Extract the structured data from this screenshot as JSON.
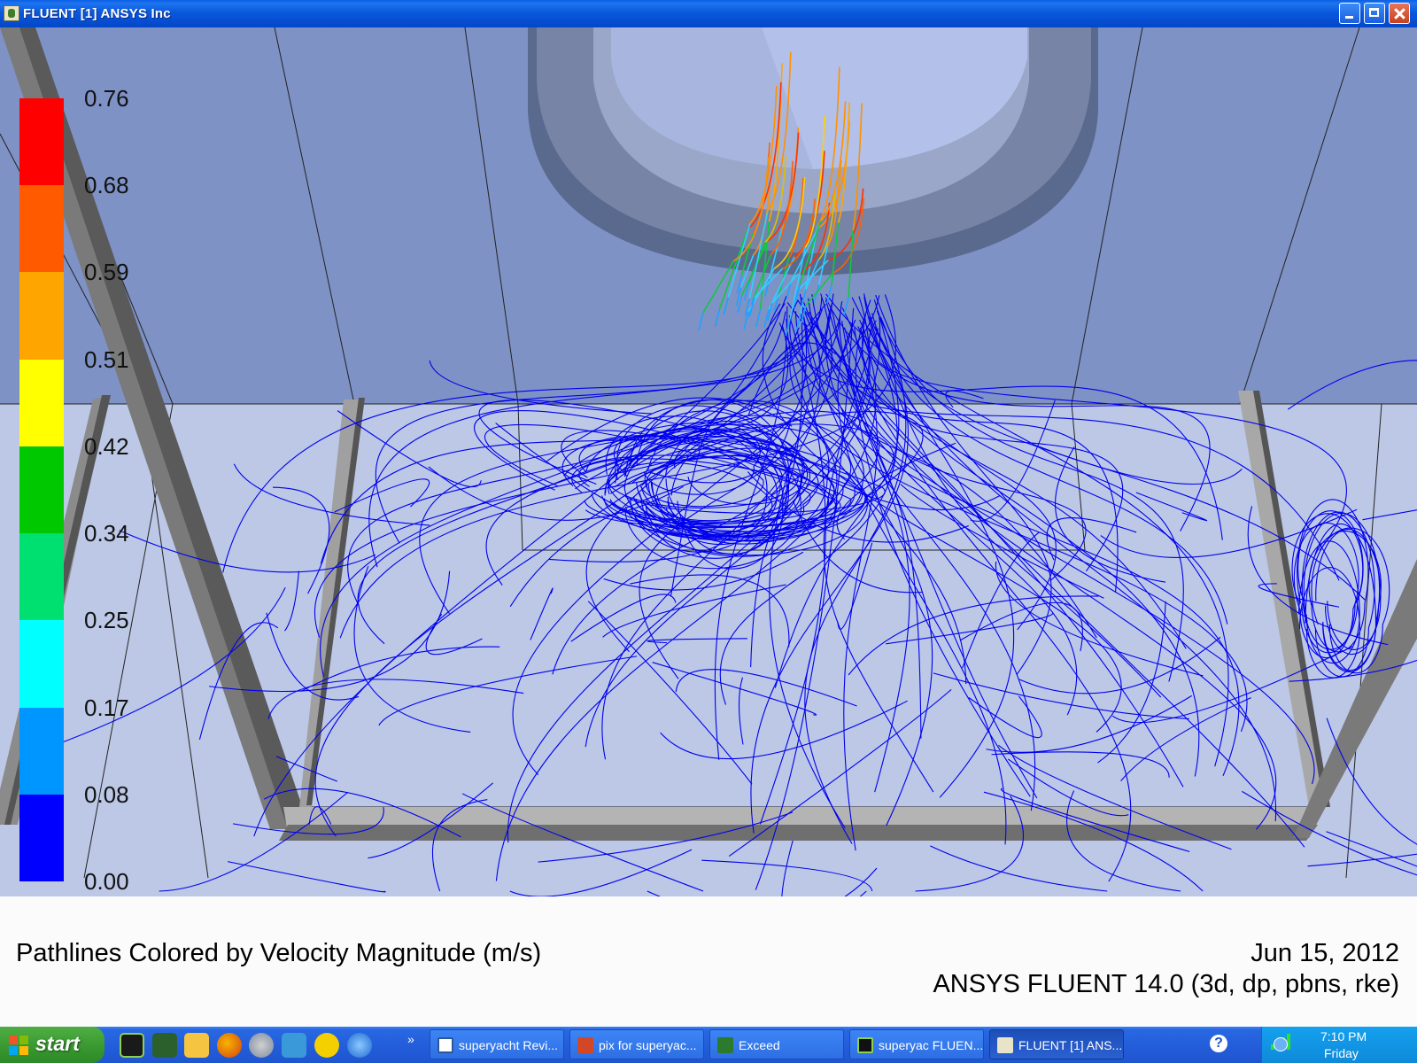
{
  "window": {
    "title": "FLUENT [1] ANSYS Inc"
  },
  "legend": {
    "labels": [
      "0.76",
      "0.68",
      "0.59",
      "0.51",
      "0.42",
      "0.34",
      "0.25",
      "0.17",
      "0.08",
      "0.00"
    ],
    "colors": [
      "#ff0000",
      "#ff5a00",
      "#ffa500",
      "#ffff00",
      "#00c800",
      "#00e070",
      "#00ffff",
      "#0096ff",
      "#0000ff"
    ]
  },
  "caption": {
    "title": "Pathlines Colored by Velocity Magnitude (m/s)",
    "date": "Jun 15, 2012",
    "version": "ANSYS FLUENT 14.0 (3d, dp, pbns, rke)"
  },
  "taskbar": {
    "start_label": "start",
    "tasks": [
      {
        "label": "superyacht Revi...",
        "icon": "word-doc-icon"
      },
      {
        "label": "pix for superyac...",
        "icon": "powerpoint-icon"
      },
      {
        "label": "Exceed",
        "icon": "exceed-icon"
      },
      {
        "label": "superyac FLUEN...",
        "icon": "fluent-icon"
      },
      {
        "label": "FLUENT [1] ANS...",
        "icon": "fluent-window-icon"
      }
    ],
    "overflow_label": "»",
    "clock": "7:10 PM",
    "day": "Friday"
  },
  "colors": {
    "pathline_blue": "#0000ee",
    "wall_gray": "#6e6e6e",
    "floor": "#bcc8e6",
    "wall": "#7f92c6"
  }
}
